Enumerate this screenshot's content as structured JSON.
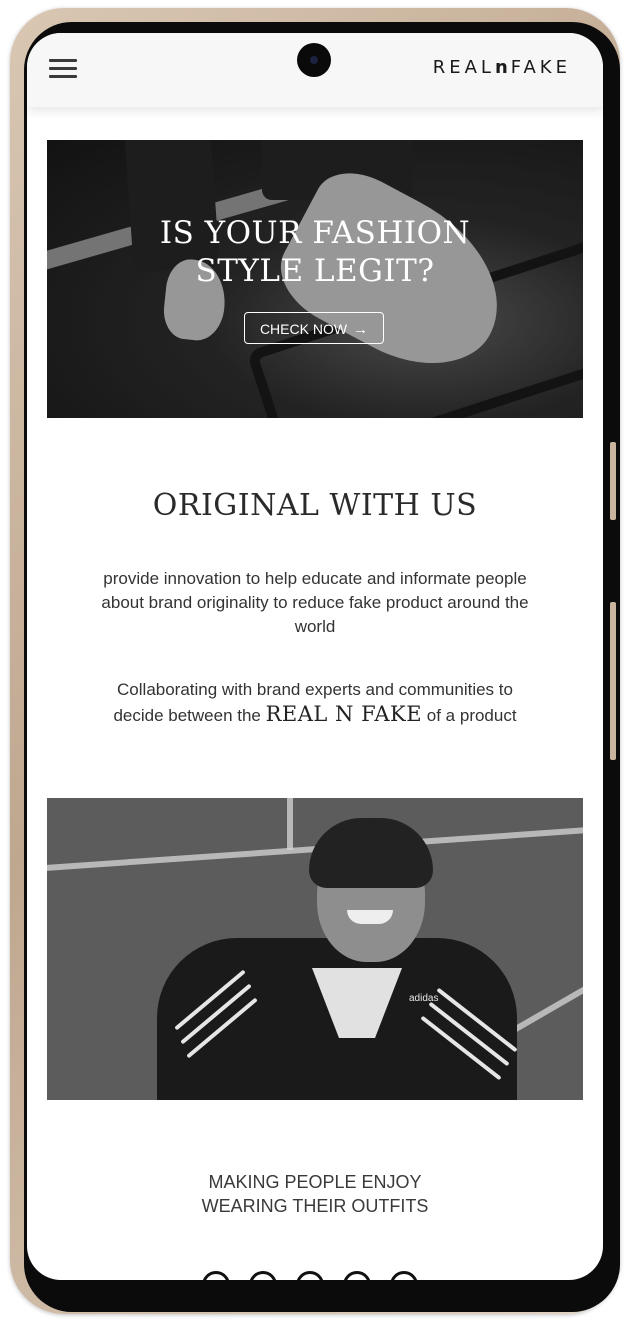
{
  "header": {
    "brand_part1": "REAL",
    "brand_part2": "n",
    "brand_part3": "FAKE",
    "menu_icon": "hamburger-menu-icon"
  },
  "hero": {
    "title_line1": "IS YOUR FASHION",
    "title_line2": "STYLE LEGIT?",
    "cta_label": "CHECK NOW",
    "cta_icon": "arrow-right-icon",
    "cta_arrow": "→"
  },
  "about": {
    "title": "ORIGINAL WITH US",
    "paragraph1": "provide innovation to help educate and informate people about brand originality to reduce fake product around the world",
    "paragraph2_before": "Collaborating with brand experts and communities to decide between the",
    "paragraph2_emphasis": "REAL N FAKE",
    "paragraph2_after": "of a product"
  },
  "kid_photo": {
    "shirt_brand": "adidas"
  },
  "tagline": {
    "line1": "MAKING PEOPLE ENJOY",
    "line2": "WEARING THEIR OUTFITS"
  },
  "colors": {
    "frame": "#c9b49e",
    "text_dark": "#2a2a2a",
    "header_bg": "#f7f7f7"
  }
}
